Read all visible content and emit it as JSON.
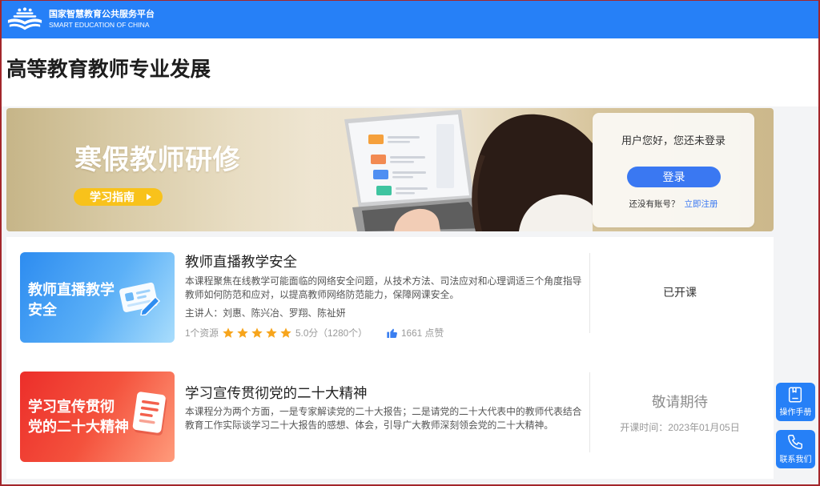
{
  "header": {
    "logo_title": "国家智慧教育公共服务平台",
    "logo_subtitle": "SMART EDUCATION OF CHINA",
    "logo_icon": "logo-icon"
  },
  "page": {
    "title": "高等教育教师专业发展"
  },
  "banner": {
    "heading": "寒假教师研修",
    "guide_button": "学习指南",
    "guide_icon": "triangle-right-icon"
  },
  "login": {
    "greeting": "用户您好，您还未登录",
    "login_button": "登录",
    "no_account_text": "还没有账号？",
    "register_link": "立即注册"
  },
  "courses": [
    {
      "thumb_lines": [
        "教师直播教学",
        "安全"
      ],
      "thumb_icon": "card-edit-icon",
      "title": "教师直播教学安全",
      "description": "本课程聚焦在线教学可能面临的网络安全问题，从技术方法、司法应对和心理调适三个角度指导教师如何防范和应对，以提高教师网络防范能力，保障网课安全。",
      "lecturers": "主讲人：刘惠、陈兴冶、罗翔、陈祉妍",
      "resources": "1个资源",
      "rating_stars": 5,
      "rating_max": 5,
      "score": "5.0分（1280个）",
      "like_icon": "thumbs-up-icon",
      "likes": "1661 点赞",
      "status": "已开课"
    },
    {
      "thumb_lines": [
        "学习宣传贯彻",
        "党的二十大精神"
      ],
      "thumb_icon": "document-icon",
      "title": "学习宣传贯彻党的二十大精神",
      "description": "本课程分为两个方面，一是专家解读党的二十大报告；二是请党的二十大代表中的教师代表结合教育工作实际谈学习二十大报告的感想、体会，引导广大教师深刻领会党的二十大精神。",
      "status": "敬请期待",
      "start_time": "开课时间：2023年01月05日"
    }
  ],
  "float_buttons": [
    {
      "label": "操作手册",
      "icon": "manual-icon"
    },
    {
      "label": "联系我们",
      "icon": "phone-icon"
    }
  ],
  "colors": {
    "header_blue": "#2680f7",
    "primary_blue": "#3a78f2",
    "guide_yellow": "#f8c21b",
    "star_orange": "#f7a51c",
    "frame_red": "#a3262b"
  }
}
